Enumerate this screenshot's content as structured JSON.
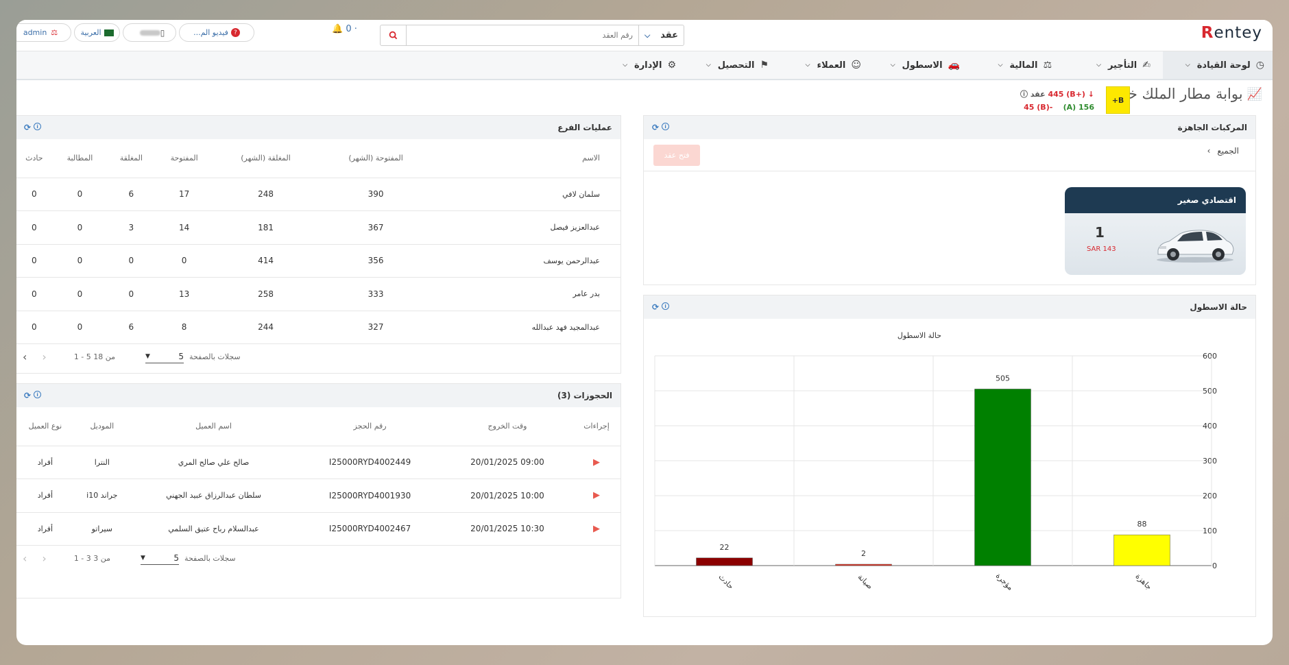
{
  "header": {
    "logo": "Rentey",
    "search": {
      "type_label": "عقد",
      "placeholder": "رقم العقد"
    },
    "notifications": "0 ·",
    "video_label": "فيديو الم...",
    "language": "العربية",
    "user": "admin"
  },
  "nav": [
    {
      "label": "لوحة القيادة",
      "icon": "dashboard-icon"
    },
    {
      "label": "التأجير",
      "icon": "rental-icon"
    },
    {
      "label": "المالية",
      "icon": "finance-icon"
    },
    {
      "label": "الاسطول",
      "icon": "car-icon"
    },
    {
      "label": "العملاء",
      "icon": "customers-icon"
    },
    {
      "label": "التحصيل",
      "icon": "collection-icon"
    },
    {
      "label": "الإدارة",
      "icon": "gear-icon"
    }
  ],
  "page": {
    "title": "بوابة مطار الملك خالد",
    "grade": "B+",
    "stats": {
      "contracts_label": "عقد",
      "b_plus": "(+B) 445",
      "a_value": "156 (A)",
      "b_value": "-45 (B)"
    }
  },
  "branch_ops": {
    "title": "عمليات الفرع",
    "columns": [
      "الاسم",
      "المفتوحة (الشهر)",
      "المغلقة (الشهر)",
      "المفتوحة",
      "المغلقة",
      "المطالبة",
      "حادث"
    ],
    "rows": [
      [
        "سلمان لافي",
        "390",
        "248",
        "17",
        "6",
        "0",
        "0"
      ],
      [
        "عبدالعزيز فيصل",
        "367",
        "181",
        "14",
        "3",
        "0",
        "0"
      ],
      [
        "عبدالرحمن يوسف",
        "356",
        "414",
        "0",
        "0",
        "0",
        "0"
      ],
      [
        "بدر عامر",
        "333",
        "258",
        "13",
        "0",
        "0",
        "0"
      ],
      [
        "عبدالمجيد فهد عبدالله",
        "327",
        "244",
        "8",
        "6",
        "0",
        "0"
      ]
    ],
    "pager": {
      "per_page_label": "سجلات بالصفحة",
      "per_page": "5",
      "range": "1 - 5 من 18"
    }
  },
  "bookings": {
    "title": "الحجوزات (3)",
    "columns": [
      "إجراءات",
      "وقت الخروج",
      "رقم الحجز",
      "اسم العميل",
      "الموديل",
      "نوع العميل"
    ],
    "rows": [
      [
        "09:00 20/01/2025",
        "I25000RYD4002449",
        "صالح علي صالح المري",
        "النترا",
        "أفراد"
      ],
      [
        "10:00 20/01/2025",
        "I25000RYD4001930",
        "سلطان عبدالرزاق عبيد الجهني",
        "جراند i10",
        "أفراد"
      ],
      [
        "10:30 20/01/2025",
        "I25000RYD4002467",
        "عبدالسلام رباح عتيق السلمي",
        "سيراتو",
        "أفراد"
      ]
    ],
    "pager": {
      "per_page_label": "سجلات بالصفحة",
      "per_page": "5",
      "range": "1 - 3 من 3"
    }
  },
  "ready_vehicles": {
    "title": "المركبات الجاهزة",
    "breadcrumb": "الجميع",
    "open_contract": "فتح عقد",
    "card": {
      "category": "اقتصادي صغير",
      "count": "1",
      "price": "SAR 143"
    }
  },
  "fleet_status": {
    "title": "حالة الاسطول",
    "chart_data": {
      "type": "bar",
      "title": "حالة الاسطول",
      "categories": [
        "جاهزة",
        "مؤجرة",
        "صيانة",
        "حادث"
      ],
      "values": [
        88,
        505,
        2,
        22
      ],
      "colors": [
        "#ffff00",
        "#008000",
        "#e03020",
        "#8b0000"
      ],
      "ylim": [
        0,
        600
      ],
      "yticks": [
        0,
        100,
        200,
        300,
        400,
        500,
        600
      ],
      "grid": true
    }
  }
}
